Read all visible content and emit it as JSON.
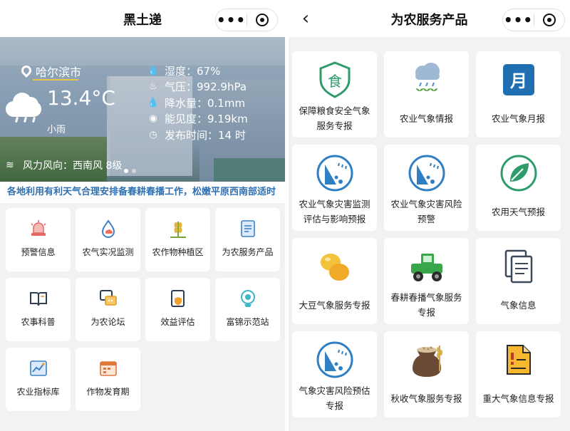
{
  "left": {
    "title": "黑土递",
    "weather": {
      "city": "哈尔滨市",
      "temperature": "13.4°C",
      "condition": "小雨",
      "humidity": "湿度：67%",
      "pressure": "气压：992.9hPa",
      "precipitation": "降水量：0.1mm",
      "visibility": "能见度：9.19km",
      "release_time": "发布时间：14 时",
      "wind": "风力风向：西南风 8级"
    },
    "marquee": "各地利用有利天气合理安排备春耕春播工作，松嫩平原西南部适时",
    "menu": [
      {
        "label": "预警信息",
        "icon": "alarm-light-icon"
      },
      {
        "label": "农气实况监测",
        "icon": "weather-drop-icon"
      },
      {
        "label": "农作物种植区",
        "icon": "wheat-icon"
      },
      {
        "label": "为农服务产品",
        "icon": "document-icon"
      },
      {
        "label": "农事科普",
        "icon": "open-book-icon"
      },
      {
        "label": "为农论坛",
        "icon": "chat-bubbles-icon"
      },
      {
        "label": "效益评估",
        "icon": "shield-document-icon"
      },
      {
        "label": "富锦示范站",
        "icon": "station-icon"
      },
      {
        "label": "农业指标库",
        "icon": "chart-icon"
      },
      {
        "label": "作物发育期",
        "icon": "calendar-icon"
      }
    ]
  },
  "right": {
    "title": "为农服务产品",
    "products": [
      {
        "label": "保障粮食安全气象服务专报",
        "icon": "food-badge-icon"
      },
      {
        "label": "农业气象情报",
        "icon": "rain-cloud-sprout-icon"
      },
      {
        "label": "农业气象月报",
        "icon": "month-calendar-icon",
        "glyph": "月"
      },
      {
        "label": "农业气象灾害监测评估与影响预报",
        "icon": "landslide-warning-icon"
      },
      {
        "label": "农业气象灾害风险预警",
        "icon": "landslide-warning-icon"
      },
      {
        "label": "农用天气预报",
        "icon": "leaf-icon"
      },
      {
        "label": "大豆气象服务专报",
        "icon": "soybean-icon"
      },
      {
        "label": "春耕春播气象服务专报",
        "icon": "tractor-icon"
      },
      {
        "label": "气象信息",
        "icon": "documents-icon"
      },
      {
        "label": "气象灾害风险预估专报",
        "icon": "landslide-warning-icon"
      },
      {
        "label": "秋收气象服务专报",
        "icon": "grain-sack-icon"
      },
      {
        "label": "重大气象信息专报",
        "icon": "alert-document-icon"
      }
    ]
  }
}
